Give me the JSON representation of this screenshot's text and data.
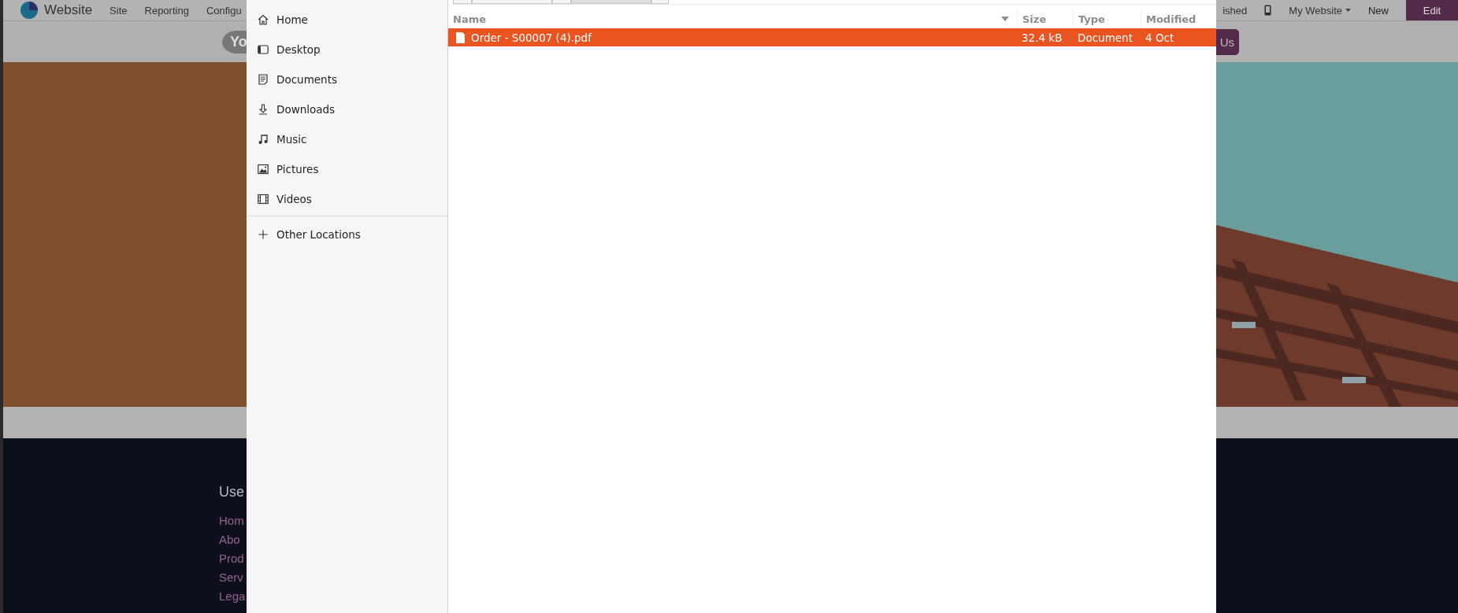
{
  "website": {
    "navbar": {
      "app_name": "Website",
      "menu": [
        "Site",
        "Reporting",
        "Configu"
      ],
      "status": "ished",
      "site_selector": "My Website",
      "new_button": "New",
      "edit_button": "Edit"
    },
    "header": {
      "logo_text": "Yo",
      "cta_button": "Us"
    },
    "footer": {
      "heading": "Use",
      "links": [
        "Hom",
        "Abo",
        "Prod",
        "Serv",
        "Lega"
      ]
    }
  },
  "file_dialog": {
    "places": [
      {
        "label": "Home",
        "kind": "home"
      },
      {
        "label": "Desktop",
        "kind": "desktop"
      },
      {
        "label": "Documents",
        "kind": "documents"
      },
      {
        "label": "Downloads",
        "kind": "downloads"
      },
      {
        "label": "Music",
        "kind": "music"
      },
      {
        "label": "Pictures",
        "kind": "pictures"
      },
      {
        "label": "Videos",
        "kind": "videos"
      }
    ],
    "other_locations": "Other Locations",
    "columns": [
      "Name",
      "Size",
      "Type",
      "Modified"
    ],
    "files": [
      {
        "name": "Order - S00007 (4).pdf",
        "size": "32.4 kB",
        "type": "Document",
        "modified": "4 Oct",
        "selected": true
      }
    ]
  }
}
